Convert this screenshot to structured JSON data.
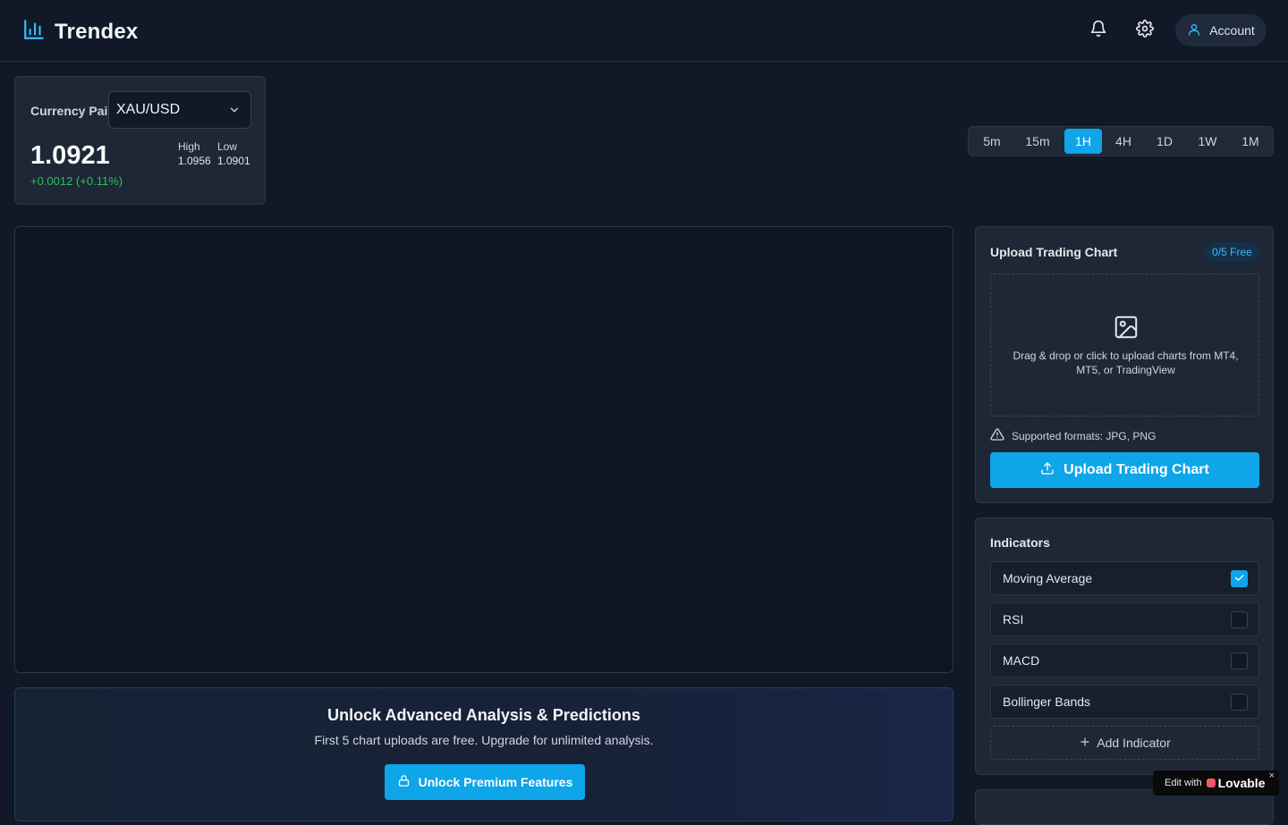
{
  "header": {
    "app_name": "Trendex",
    "account_label": "Account"
  },
  "pair": {
    "label": "Currency Pair",
    "selected": "XAU/USD",
    "price": "1.0921",
    "change": "+0.0012 (+0.11%)",
    "high_label": "High",
    "high_value": "1.0956",
    "low_label": "Low",
    "low_value": "1.0901"
  },
  "timeframes": {
    "items": [
      "5m",
      "15m",
      "1H",
      "4H",
      "1D",
      "1W",
      "1M"
    ],
    "active": "1H"
  },
  "promo": {
    "title": "Unlock Advanced Analysis & Predictions",
    "subtitle": "First 5 chart uploads are free. Upgrade for unlimited analysis.",
    "button": "Unlock Premium Features"
  },
  "upload": {
    "title": "Upload Trading Chart",
    "badge": "0/5 Free",
    "dropzone_text": "Drag & drop or click to upload charts from MT4, MT5, or TradingView",
    "formats": "Supported formats: JPG, PNG",
    "button": "Upload Trading Chart"
  },
  "indicators": {
    "title": "Indicators",
    "items": [
      {
        "label": "Moving Average",
        "checked": true
      },
      {
        "label": "RSI",
        "checked": false
      },
      {
        "label": "MACD",
        "checked": false
      },
      {
        "label": "Bollinger Bands",
        "checked": false
      }
    ],
    "add_label": "Add Indicator"
  },
  "badge": {
    "edit_with": "Edit with",
    "brand": "Lovable",
    "close": "×"
  },
  "colors": {
    "accent": "#0ea5e9",
    "positive": "#22c55e",
    "background": "#111827",
    "card": "#1e2736"
  }
}
